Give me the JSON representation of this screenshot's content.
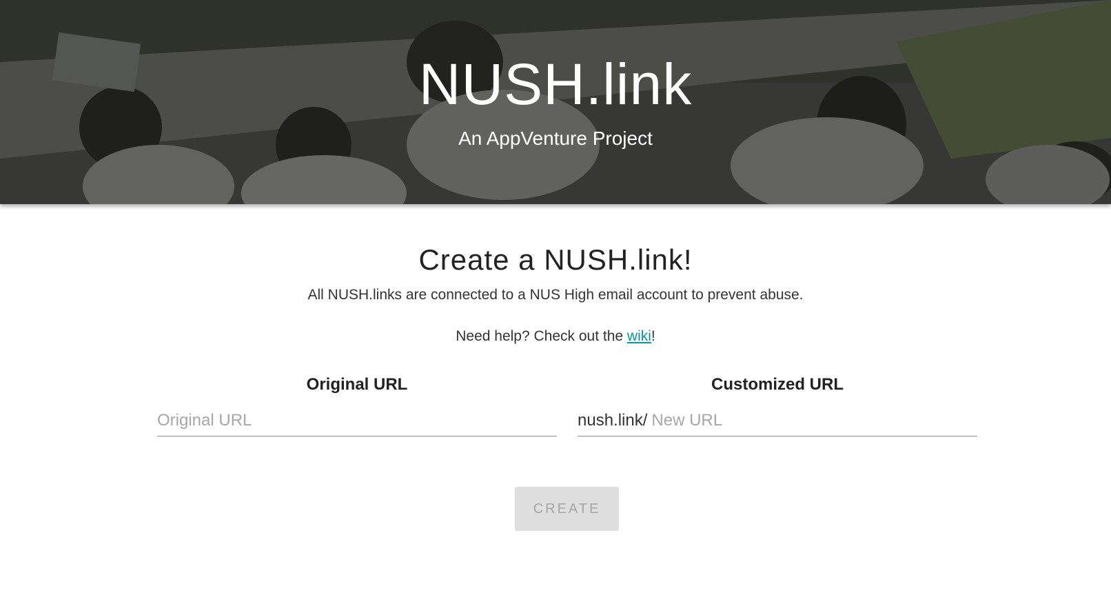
{
  "hero": {
    "title": "NUSH.link",
    "subtitle": "An AppVenture Project"
  },
  "main": {
    "heading": "Create a NUSH.link!",
    "intro": "All NUSH.links are connected to a NUS High email account to prevent abuse.",
    "help_prefix": "Need help? Check out the ",
    "help_link": "wiki",
    "help_suffix": "!"
  },
  "form": {
    "original": {
      "label": "Original URL",
      "placeholder": "Original URL",
      "value": ""
    },
    "custom": {
      "label": "Customized URL",
      "prefix": "nush.link/",
      "placeholder": "New URL",
      "value": ""
    },
    "create_label": "CREATE",
    "create_enabled": false
  },
  "colors": {
    "link": "#0097a7",
    "button_bg": "#dfdfdf",
    "button_text": "#a5a5a5",
    "hero_text": "#ffffff"
  }
}
